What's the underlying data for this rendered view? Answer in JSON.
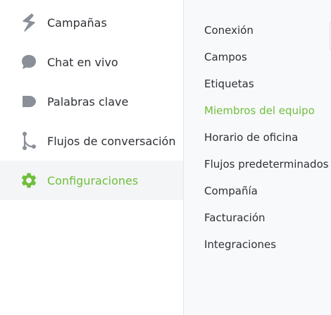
{
  "sidebar": {
    "items": [
      {
        "label": "Campañas",
        "icon": "campaigns-icon",
        "active": false
      },
      {
        "label": "Chat en vivo",
        "icon": "chat-bubble-icon",
        "active": false
      },
      {
        "label": "Palabras clave",
        "icon": "keywords-tag-icon",
        "active": false
      },
      {
        "label": "Flujos de conversación",
        "icon": "flow-branch-icon",
        "active": false
      },
      {
        "label": "Configuraciones",
        "icon": "gear-icon",
        "active": true
      }
    ]
  },
  "settings_menu": {
    "items": [
      {
        "label": "Conexión",
        "active": false
      },
      {
        "label": "Campos",
        "active": false
      },
      {
        "label": "Etiquetas",
        "active": false
      },
      {
        "label": "Miembros del equipo",
        "active": true
      },
      {
        "label": "Horario de oficina",
        "active": false
      },
      {
        "label": "Flujos predeterminados",
        "active": false
      },
      {
        "label": "Compañía",
        "active": false
      },
      {
        "label": "Facturación",
        "active": false
      },
      {
        "label": "Integraciones",
        "active": false
      }
    ]
  },
  "colors": {
    "accent": "#6fbf3b",
    "icon_gray": "#8a8f98",
    "text": "#2d3035",
    "active_bg": "#f4f5f7",
    "submenu_bg": "#f8f9fb"
  }
}
